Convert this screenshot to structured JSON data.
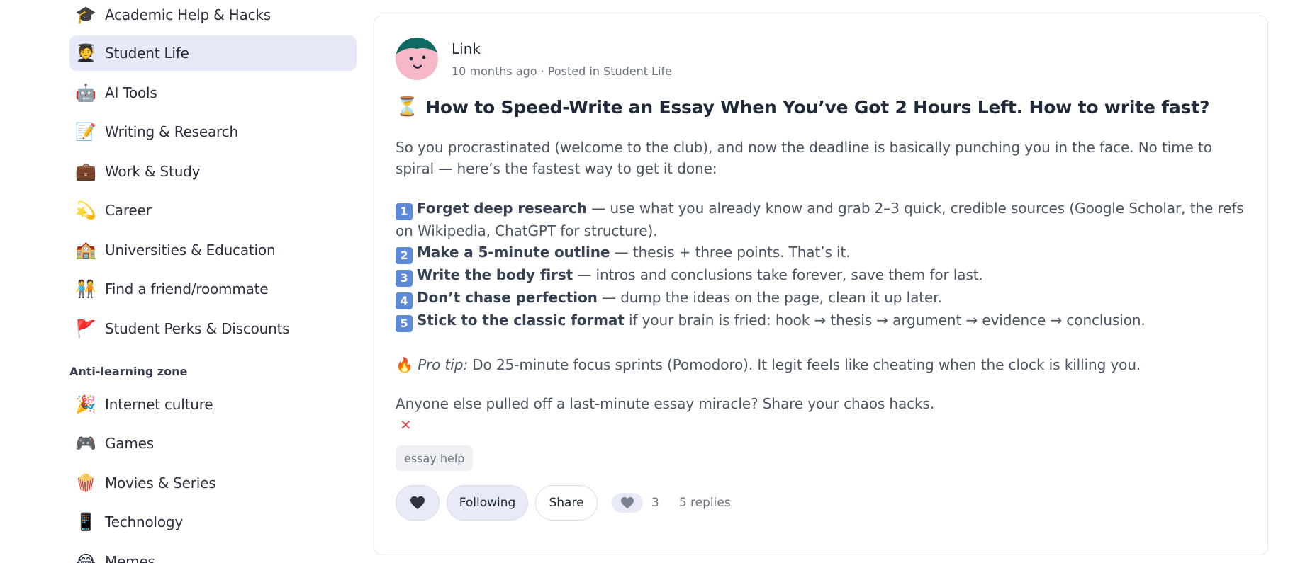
{
  "sidebar": {
    "items": [
      {
        "label": "Academic Help & Hacks",
        "icon": "graduation-cap-icon",
        "emoji": "🎓"
      },
      {
        "label": "Student Life",
        "icon": "student-icon",
        "emoji": "🧑‍🎓",
        "active": true
      },
      {
        "label": "AI Tools",
        "icon": "robot-icon",
        "emoji": "🤖"
      },
      {
        "label": "Writing & Research",
        "icon": "memo-icon",
        "emoji": "📝"
      },
      {
        "label": "Work & Study",
        "icon": "briefcase-icon",
        "emoji": "💼"
      },
      {
        "label": "Career",
        "icon": "dizzy-star-icon",
        "emoji": "💫"
      },
      {
        "label": "Universities & Education",
        "icon": "school-icon",
        "emoji": "🏫"
      },
      {
        "label": "Find a friend/roommate",
        "icon": "people-holding-hands-icon",
        "emoji": "🧑‍🤝‍🧑"
      },
      {
        "label": "Student Perks & Discounts",
        "icon": "red-flag-icon",
        "emoji": "🚩"
      }
    ],
    "section_title": "Anti-learning zone",
    "section_items": [
      {
        "label": "Internet culture",
        "icon": "party-popper-icon",
        "emoji": "🎉"
      },
      {
        "label": "Games",
        "icon": "game-controller-icon",
        "emoji": "🎮"
      },
      {
        "label": "Movies & Series",
        "icon": "popcorn-icon",
        "emoji": "🍿"
      },
      {
        "label": "Technology",
        "icon": "mobile-phone-icon",
        "emoji": "📱"
      },
      {
        "label": "Memes",
        "icon": "tears-of-joy-icon",
        "emoji": "😂"
      }
    ]
  },
  "post": {
    "author": "Link",
    "time": "10 months ago",
    "posted_in_prefix": "· Posted in",
    "category": "Student Life",
    "title_emoji": "⏳",
    "title": "How to Speed-Write an Essay When You’ve Got 2 Hours Left. How to write fast?",
    "intro": "So you procrastinated (welcome to the club), and now the deadline is basically punching you in the face. No time to spiral — here’s the fastest way to get it done:",
    "steps": [
      {
        "num": "1",
        "bold": "Forget deep research",
        "rest": " — use what you already know and grab 2–3 quick, credible sources (Google Scholar, the refs on Wikipedia, ChatGPT for structure)."
      },
      {
        "num": "2",
        "bold": "Make a 5-minute outline",
        "rest": " — thesis + three points. That’s it."
      },
      {
        "num": "3",
        "bold": "Write the body first",
        "rest": " — intros and conclusions take forever, save them for last."
      },
      {
        "num": "4",
        "bold": "Don’t chase perfection",
        "rest": " — dump the ideas on the page, clean it up later."
      },
      {
        "num": "5",
        "bold": "Stick to the classic format",
        "rest": " if your brain is fried: hook → thesis → argument → evidence → conclusion."
      }
    ],
    "protip_emoji": "🔥",
    "protip_label": "Pro tip:",
    "protip_text": " Do 25-minute focus sprints (Pomodoro). It legit feels like cheating when the clock is killing you.",
    "outro": "Anyone else pulled off a last-minute essay miracle? Share your chaos hacks.",
    "close_mark": "✕",
    "tag": "essay help",
    "actions": {
      "following_label": "Following",
      "share_label": "Share",
      "like_count": "3",
      "replies": "5 replies"
    }
  },
  "colors": {
    "active_bg": "#e6eaf8",
    "button_bg": "#e8ebf7",
    "avatar_face": "#f6b8c6",
    "avatar_hair": "#0d6b63"
  }
}
